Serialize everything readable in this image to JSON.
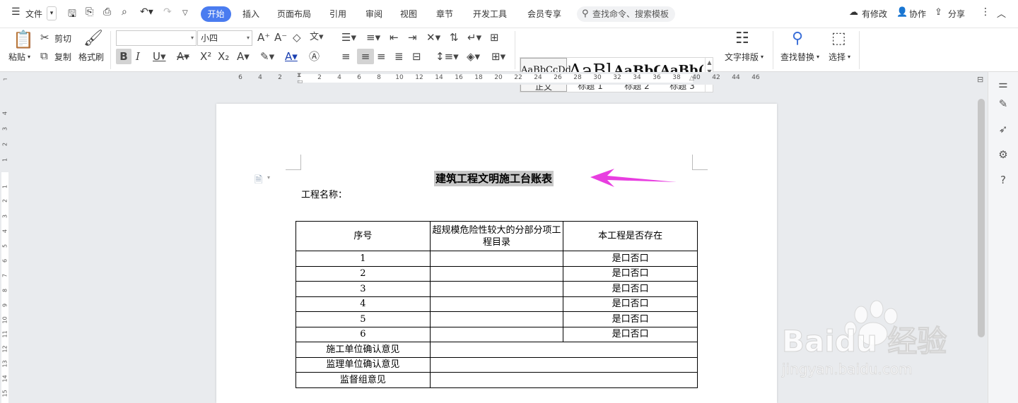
{
  "menubar": {
    "file_menu": "文件",
    "tabs": [
      "开始",
      "插入",
      "页面布局",
      "引用",
      "审阅",
      "视图",
      "章节",
      "开发工具",
      "会员专享"
    ],
    "search_placeholder": "查找命令、搜索模板",
    "has_changes": "有修改",
    "collaborate": "协作",
    "share": "分享"
  },
  "ribbon": {
    "paste": "粘贴",
    "cut": "剪切",
    "copy": "复制",
    "format_painter": "格式刷",
    "font_name": "",
    "font_size": "小四",
    "styles": [
      {
        "preview": "AaBbCcDd",
        "name": "正文"
      },
      {
        "preview": "AaBl",
        "name": "标题 1"
      },
      {
        "preview": "AaBbC",
        "name": "标题 2"
      },
      {
        "preview": "AaBb(",
        "name": "标题 3"
      }
    ],
    "text_layout": "文字排版",
    "find_replace": "查找替换",
    "select": "选择"
  },
  "ruler": {
    "h_ticks": [
      "6",
      "4",
      "2",
      "2",
      "4",
      "6",
      "8",
      "10",
      "12",
      "14",
      "16",
      "18",
      "20",
      "22",
      "24",
      "26",
      "28",
      "30",
      "32",
      "34",
      "36",
      "38",
      "40",
      "42",
      "44",
      "46"
    ],
    "v_ticks": [
      "4",
      "3",
      "2",
      "1",
      "1",
      "2",
      "3",
      "4",
      "5",
      "6",
      "7",
      "8",
      "9",
      "10",
      "11",
      "12",
      "13",
      "14",
      "15"
    ]
  },
  "document": {
    "title": "建筑工程文明施工台账表",
    "project_label": "工程名称：",
    "table": {
      "headers": [
        "序号",
        "超规模危险性较大的分部分项工程目录",
        "本工程是否存在"
      ],
      "rows": [
        [
          "1",
          "",
          "是口否口"
        ],
        [
          "2",
          "",
          "是口否口"
        ],
        [
          "3",
          "",
          "是口否口"
        ],
        [
          "4",
          "",
          "是口否口"
        ],
        [
          "5",
          "",
          "是口否口"
        ],
        [
          "6",
          "",
          "是口否口"
        ]
      ],
      "opinions": [
        "施工单位确认意见",
        "监理单位确认意见",
        "监督组意见"
      ]
    }
  },
  "watermark": {
    "brand": "Baidu 经验",
    "url": "jingyan.baidu.com"
  },
  "colors": {
    "accent": "#4a7cf0",
    "arrow": "#e83ee0"
  }
}
